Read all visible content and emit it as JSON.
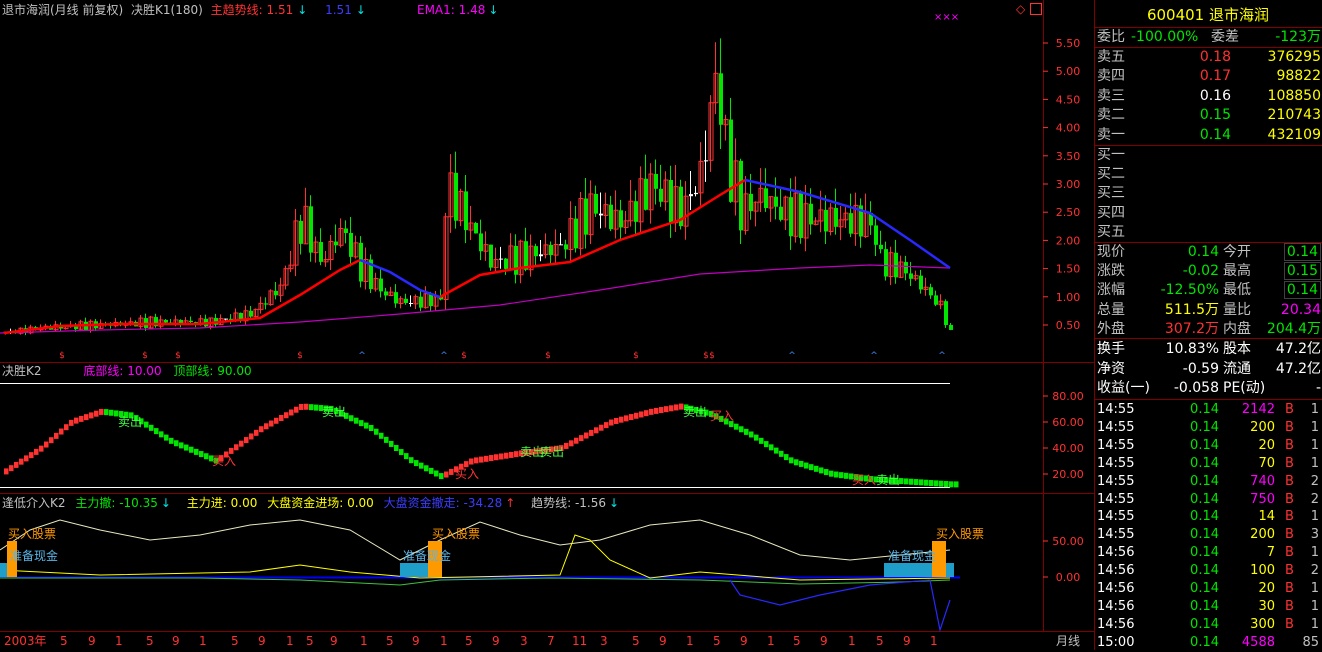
{
  "chart_header": {
    "name": "退市海润(月线 前复权)",
    "k1_label": "决胜K1(180)",
    "trend_label": "主趋势线:",
    "trend_value": "1.51",
    "trend_arrow": "↓",
    "blue_value": "1.51",
    "blue_arrow": "↓",
    "ema_label": "EMA1:",
    "ema_value": "1.48",
    "ema_arrow": "↓",
    "corner_marks": "×××",
    "diamond": "◇"
  },
  "k2_header": {
    "title": "决胜K2",
    "bottom_label": "底部线:",
    "bottom_value": "10.00",
    "top_label": "顶部线:",
    "top_value": "90.00"
  },
  "k3_header": {
    "title": "逢低介入K2",
    "main_sell_label": "主力撤:",
    "main_sell_value": "-10.35",
    "main_sell_arrow": "↓",
    "main_buy_label": "主力进:",
    "main_buy_value": "0.00",
    "market_in_label": "大盘资金进场:",
    "market_in_value": "0.00",
    "market_out_label": "大盘资金撤走:",
    "market_out_value": "-34.28",
    "market_out_arrow": "↑",
    "trend_label": "趋势线:",
    "trend_value": "-1.56",
    "trend_arrow": "↓"
  },
  "price_axis": [
    "5.50",
    "5.00",
    "4.50",
    "4.00",
    "3.50",
    "3.00",
    "2.50",
    "2.00",
    "1.50",
    "1.00",
    "0.50"
  ],
  "k2_axis": [
    "80.00",
    "60.00",
    "40.00",
    "20.00"
  ],
  "k3_axis": [
    "50.00",
    "0.00"
  ],
  "k2_signals": [
    "卖出",
    "买入",
    "卖出",
    "买入",
    "卖出",
    "卖出",
    "卖出",
    "买入",
    "买入",
    "卖出"
  ],
  "k3_signals": {
    "buy": "买入股票",
    "prepare": "准备现金"
  },
  "time_axis": {
    "start": "2003年",
    "ticks": [
      "5",
      "9",
      "1",
      "5",
      "9",
      "1",
      "5",
      "9",
      "1",
      "5",
      "9",
      "1",
      "5",
      "9",
      "1",
      "5",
      "9",
      "3",
      "7",
      "11",
      "3",
      "5",
      "9",
      "1",
      "5",
      "9",
      "1",
      "5",
      "9",
      "1",
      "5",
      "9",
      "1",
      "5",
      "9",
      "1",
      "5",
      "9",
      "1"
    ],
    "period": "月线"
  },
  "quote": {
    "code": "600401",
    "name": "退市海润",
    "weibi_label": "委比",
    "weibi_value": "-100.00%",
    "weicha_label": "委差",
    "weicha_value": "-123万",
    "asks": [
      {
        "label": "卖五",
        "price": "0.18",
        "vol": "376295"
      },
      {
        "label": "卖四",
        "price": "0.17",
        "vol": "98822"
      },
      {
        "label": "卖三",
        "price": "0.16",
        "vol": "108850"
      },
      {
        "label": "卖二",
        "price": "0.15",
        "vol": "210743"
      },
      {
        "label": "卖一",
        "price": "0.14",
        "vol": "432109"
      }
    ],
    "bids": [
      "买一",
      "买二",
      "买三",
      "买四",
      "买五"
    ],
    "stats": [
      {
        "l1": "现价",
        "v1": "0.14",
        "l2": "今开",
        "v2": "0.14"
      },
      {
        "l1": "涨跌",
        "v1": "-0.02",
        "l2": "最高",
        "v2": "0.15"
      },
      {
        "l1": "涨幅",
        "v1": "-12.50%",
        "l2": "最低",
        "v2": "0.14"
      },
      {
        "l1": "总量",
        "v1": "511.5万",
        "l2": "量比",
        "v2": "20.34"
      },
      {
        "l1": "外盘",
        "v1": "307.2万",
        "l2": "内盘",
        "v2": "204.4万"
      }
    ],
    "stats2": [
      {
        "l1": "换手",
        "v1": "10.83%",
        "l2": "股本",
        "v2": "47.2亿"
      },
      {
        "l1": "净资",
        "v1": "-0.59",
        "l2": "流通",
        "v2": "47.2亿"
      },
      {
        "l1": "收益(一)",
        "v1": "-0.058",
        "l2": "PE(动)",
        "v2": "-"
      }
    ],
    "ticks": [
      {
        "t": "14:55",
        "p": "0.14",
        "v": "2142",
        "s": "B",
        "n": "1"
      },
      {
        "t": "14:55",
        "p": "0.14",
        "v": "200",
        "s": "B",
        "n": "1"
      },
      {
        "t": "14:55",
        "p": "0.14",
        "v": "20",
        "s": "B",
        "n": "1"
      },
      {
        "t": "14:55",
        "p": "0.14",
        "v": "70",
        "s": "B",
        "n": "1"
      },
      {
        "t": "14:55",
        "p": "0.14",
        "v": "740",
        "s": "B",
        "n": "2"
      },
      {
        "t": "14:55",
        "p": "0.14",
        "v": "750",
        "s": "B",
        "n": "2"
      },
      {
        "t": "14:55",
        "p": "0.14",
        "v": "14",
        "s": "B",
        "n": "1"
      },
      {
        "t": "14:55",
        "p": "0.14",
        "v": "200",
        "s": "B",
        "n": "3"
      },
      {
        "t": "14:56",
        "p": "0.14",
        "v": "7",
        "s": "B",
        "n": "1"
      },
      {
        "t": "14:56",
        "p": "0.14",
        "v": "100",
        "s": "B",
        "n": "2"
      },
      {
        "t": "14:56",
        "p": "0.14",
        "v": "20",
        "s": "B",
        "n": "1"
      },
      {
        "t": "14:56",
        "p": "0.14",
        "v": "30",
        "s": "B",
        "n": "1"
      },
      {
        "t": "14:56",
        "p": "0.14",
        "v": "300",
        "s": "B",
        "n": "1"
      },
      {
        "t": "15:00",
        "p": "0.14",
        "v": "4588",
        "s": "",
        "n": "85"
      }
    ]
  },
  "colors": {
    "up": "#ff3232",
    "down": "#00e600",
    "flat": "#ffffff",
    "trend_red": "#ff0000",
    "trend_blue": "#2828ff",
    "ema": "#c000c0",
    "frame": "#800000",
    "signal_cyan": "#1e9ec8",
    "signal_orange": "#ff9900"
  }
}
